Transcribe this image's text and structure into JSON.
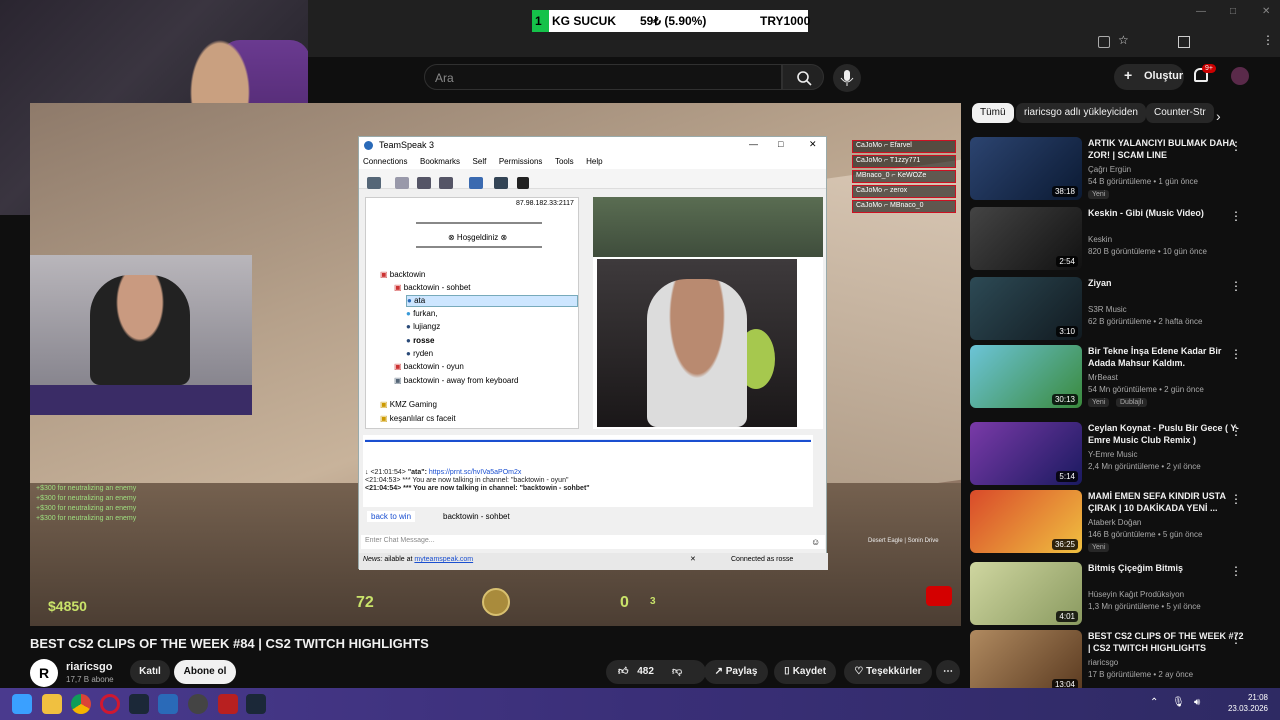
{
  "ticker": {
    "name": "KG SUCUK",
    "pct": "59₺ (5.90%)",
    "goal": "TRY1000",
    "k": "1"
  },
  "search": {
    "placeholder": "Ara"
  },
  "header": {
    "create_label": "Oluştur",
    "notif_badge": "9+"
  },
  "game": {
    "money": "$4850",
    "hp": "72",
    "ammo": "0",
    "ammo_reserve": "3",
    "killfeed": [
      "CaJoMo ⌐ Efarvel",
      "CaJoMo ⌐ T1zzy771",
      "MBnaco_0 ⌐ KeWOZe",
      "CaJoMo ⌐ zerox",
      "CaJoMo ⌐ MBnaco_0"
    ],
    "chat": [
      "+$300 for neutralizing an enemy",
      "+$300 for neutralizing an enemy",
      "+$300 for neutralizing an enemy",
      "+$300 for neutralizing an enemy"
    ],
    "weapon": "Desert Eagle | Sonin Drive"
  },
  "teamspeak": {
    "title": "TeamSpeak 3",
    "menu": [
      "Connections",
      "Bookmarks",
      "Self",
      "Permissions",
      "Tools",
      "Help"
    ],
    "ip": "87.98.182.33:2117",
    "welcome": "⊗ Hoşgeldiniz ⊗",
    "tree": {
      "server": "backtowin",
      "channel": "backtowin - sohbet",
      "users": [
        "ata",
        "furkan,",
        "lujiangz",
        "rosse",
        "ryden"
      ],
      "ch2": "backtowin - oyun",
      "ch3": "backtowin - away from keyboard",
      "ch4": "KMZ Gaming",
      "ch5": "keşanlılar cs faceit"
    },
    "chat": {
      "line1_time": "<21:01:54>",
      "line1_user": "\"ata\":",
      "line1_link": "https://prnt.sc/hvIVa5aPOm2x",
      "line2": "<21:04:53> *** You are now talking in channel: \"backtowin - oyun\"",
      "line3": "<21:04:54> *** You are now talking in channel: \"backtowin - sohbet\""
    },
    "tab1": "back to win",
    "tab2": "backtowin - sohbet",
    "input_placeholder": "Enter Chat Message...",
    "news_label": "News:",
    "news_text": "ailable at",
    "news_link": "myteamspeak.com",
    "status": "Connected as rosse"
  },
  "video": {
    "title": "BEST CS2 CLIPS OF THE WEEK #84 | CS2 TWITCH HIGHLIGHTS"
  },
  "channel": {
    "avatar": "R",
    "name": "riaricsgo",
    "subs": "17,7 B abone"
  },
  "actions": {
    "join": "Katıl",
    "subscribe": "Abone ol",
    "likes": "482",
    "share": "Paylaş",
    "save": "Kaydet",
    "thanks": "Teşekkürler"
  },
  "chips": [
    "Tümü",
    "riaricsgo adlı yükleyiciden",
    "Counter-Str"
  ],
  "recs": [
    {
      "title": "ARTIK YALANCIYI BULMAK DAHA ZOR! | SCAM LINE",
      "channel": "Çağrı Ergün",
      "meta": "54 B görüntüleme • 1 gün önce",
      "tag": "Yeni",
      "dur": "38:18",
      "c1": "#2c4470",
      "c2": "#0b1a33"
    },
    {
      "title": "Keskin - Gibi (Music Video)",
      "channel": "Keskin",
      "meta": "820 B görüntüleme • 10 gün önce",
      "tag": "",
      "dur": "2:54",
      "c1": "#444",
      "c2": "#111"
    },
    {
      "title": "Ziyan",
      "channel": "S3R Music",
      "meta": "62 B görüntüleme • 2 hafta önce",
      "tag": "",
      "dur": "3:10",
      "c1": "#2d4a55",
      "c2": "#111a20"
    },
    {
      "title": "Bir Tekne İnşa Edene Kadar Bir Adada Mahsur Kaldım.",
      "channel": "MrBeast",
      "meta": "54 Mn görüntüleme • 2 gün önce",
      "tag": "Yeni",
      "tag2": "Dublajlı",
      "dur": "30:13",
      "c1": "#6cc4d8",
      "c2": "#3a8a3c"
    },
    {
      "title": "Ceylan Koynat - Puslu Bir Gece ( Y-Emre Music Club Remix )",
      "channel": "Y-Emre Music",
      "meta": "2,4 Mn görüntüleme • 2 yıl önce",
      "tag": "",
      "dur": "5:14",
      "c1": "#7a3aa8",
      "c2": "#1a1a60"
    },
    {
      "title": "MAMİ EMEN SEFA KINDIR USTA ÇIRAK | 10 DAKİKADA YENİ ...",
      "channel": "Ataberk Doğan",
      "meta": "146 B görüntüleme • 5 gün önce",
      "tag": "Yeni",
      "dur": "36:25",
      "c1": "#d94a2a",
      "c2": "#f0c040"
    },
    {
      "title": "Bitmiş Çiçeğim Bitmiş",
      "channel": "Hüseyin Kağıt Prodüksiyon",
      "meta": "1,3 Mn görüntüleme • 5 yıl önce",
      "tag": "",
      "dur": "4:01",
      "c1": "#cfd6a0",
      "c2": "#8a9a60"
    },
    {
      "title": "BEST CS2 CLIPS OF THE WEEK #72 | CS2 TWITCH HIGHLIGHTS",
      "channel": "riaricsgo",
      "meta": "17 B görüntüleme • 2 ay önce",
      "tag": "",
      "dur": "13:04",
      "c1": "#b08a60",
      "c2": "#5a3a20"
    }
  ],
  "clock": {
    "time": "21:08",
    "date": "23.03.2026"
  }
}
